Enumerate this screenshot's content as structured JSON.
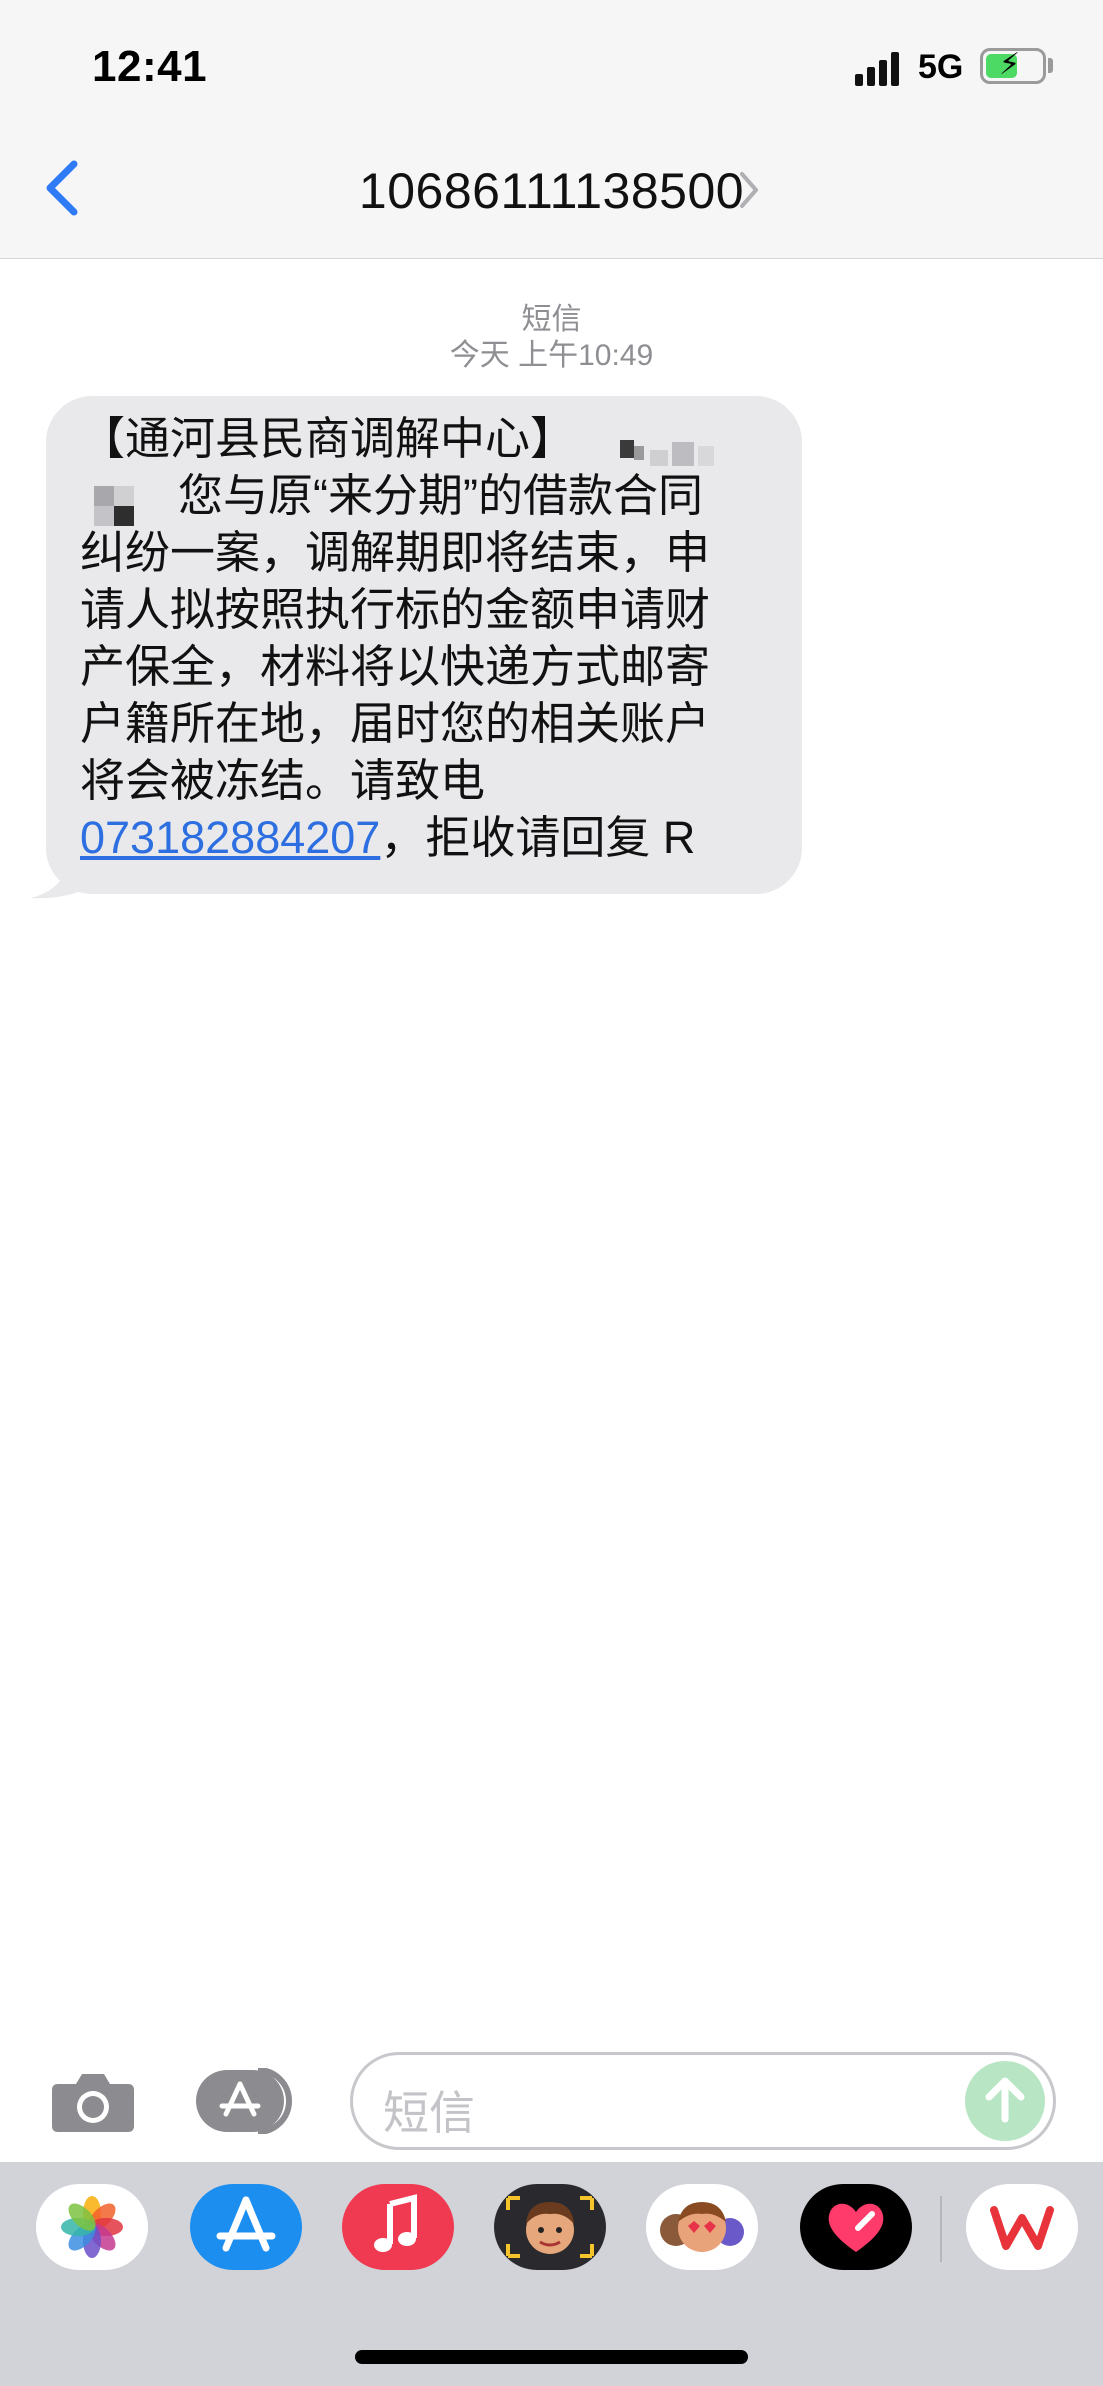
{
  "status_bar": {
    "time": "12:41",
    "network": "5G"
  },
  "header": {
    "contact": "10686111138500"
  },
  "thread": {
    "message_type": "短信",
    "timestamp": "今天 上午10:49"
  },
  "message": {
    "lines": [
      "【通河县民商调解中心】",
      "您与原“来分期”的借款合同",
      "纠纷一案，调解期即将结束，申",
      "请人拟按照执行标的金额申请财",
      "产保全，材料将以快递方式邮寄",
      "户籍所在地，届时您的相关账户",
      "将会被冻结。请致电"
    ],
    "phone_link": "073182884207",
    "tail_text": "，拒收请回复 R"
  },
  "compose": {
    "placeholder": "短信"
  },
  "app_drawer": {
    "apps": [
      "photos-app-icon",
      "app-store-app-icon",
      "music-app-icon",
      "memoji-app-icon",
      "animoji-app-icon",
      "digital-touch-app-icon",
      "wps-app-icon"
    ]
  },
  "colors": {
    "link": "#2d6fe0",
    "bubble": "#e9e9eb",
    "ios_blue": "#2f7bf5",
    "send_disabled": "#b8e6c4"
  }
}
